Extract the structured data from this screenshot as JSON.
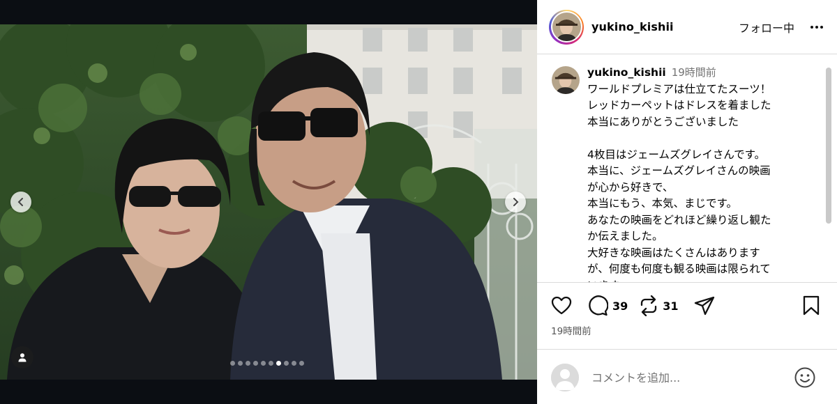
{
  "post": {
    "username": "yukino_kishii",
    "follow_label": "フォロー中",
    "more_icon": "more-horizontal-icon"
  },
  "caption": {
    "username": "yukino_kishii",
    "time": "19時間前",
    "lines": [
      "ワールドプレミアは仕立てたスーツ！",
      "レッドカーペットはドレスを着ました",
      "本当にありがとうございました",
      "",
      "4枚目はジェームズグレイさんです。",
      "本当に、ジェームズグレイさんの映画",
      "が心から好きで、",
      "本当にもう、本気、まじです。",
      "あなたの映画をどれほど繰り返し観た",
      "か伝えました。",
      "大好きな映画はたくさんはあります",
      "が、何度も何度も観る映画は限られて",
      "います。"
    ]
  },
  "actions": {
    "comment_count": "39",
    "repost_count": "31"
  },
  "post_time": "19時間前",
  "comment_box": {
    "placeholder": "コメントを追加..."
  },
  "carousel": {
    "total": 10,
    "active_index": 6
  },
  "colors": {
    "media_bg": "#0b0e13",
    "divider": "#dbdbdb",
    "muted_text": "#737373"
  }
}
